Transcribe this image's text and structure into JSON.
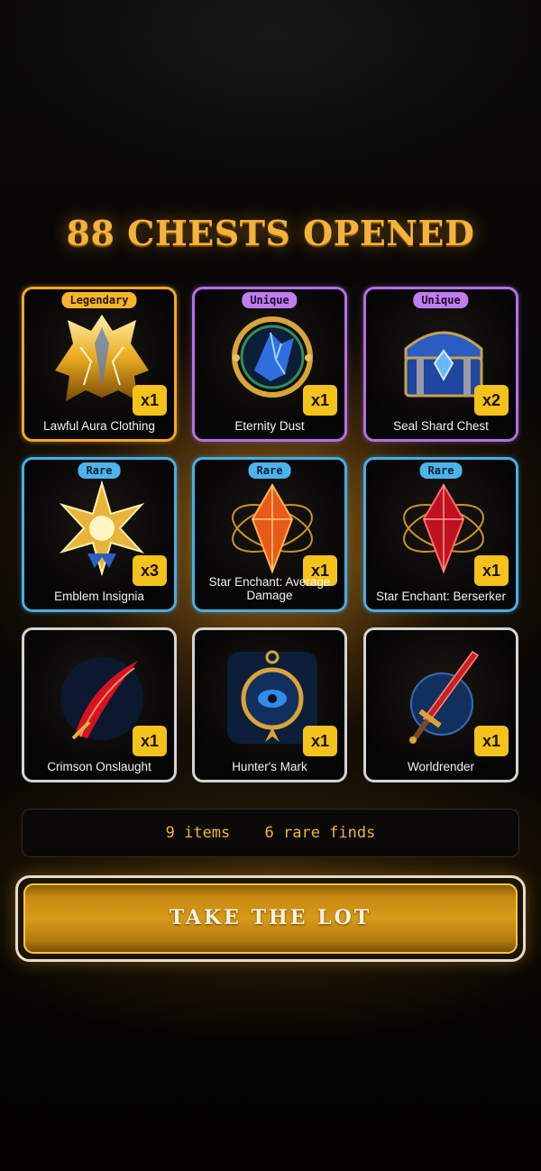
{
  "header": {
    "title": "88 CHESTS OPENED"
  },
  "items": [
    {
      "name": "Lawful Aura Clothing",
      "rarity": "Legendary",
      "qty": "x1",
      "icon": "golden-winged-cloak-icon"
    },
    {
      "name": "Eternity Dust",
      "rarity": "Unique",
      "qty": "x1",
      "icon": "crystal-ring-icon"
    },
    {
      "name": "Seal Shard Chest",
      "rarity": "Unique",
      "qty": "x2",
      "icon": "treasure-chest-icon"
    },
    {
      "name": "Emblem Insignia",
      "rarity": "Rare",
      "qty": "x3",
      "icon": "golden-star-emblem-icon"
    },
    {
      "name": "Star Enchant: Average Damage",
      "rarity": "Rare",
      "qty": "x1",
      "icon": "orange-crystal-icon"
    },
    {
      "name": "Star Enchant: Berserker",
      "rarity": "Rare",
      "qty": "x1",
      "icon": "red-crystal-icon"
    },
    {
      "name": "Crimson Onslaught",
      "rarity": "",
      "qty": "x1",
      "icon": "red-slash-icon"
    },
    {
      "name": "Hunter's Mark",
      "rarity": "",
      "qty": "x1",
      "icon": "eye-amulet-icon"
    },
    {
      "name": "Worldrender",
      "rarity": "",
      "qty": "x1",
      "icon": "flaming-sword-icon"
    }
  ],
  "summary": {
    "items_text": "9 items",
    "rare_text": "6 rare finds"
  },
  "cta": {
    "label": "TAKE THE LOT"
  },
  "colors": {
    "legendary": "#f3a81f",
    "unique": "#b56ee6",
    "rare": "#47aee6",
    "common": "#d4d4d4",
    "title": "#f4b33a",
    "qty_badge": "#f4c21a"
  }
}
